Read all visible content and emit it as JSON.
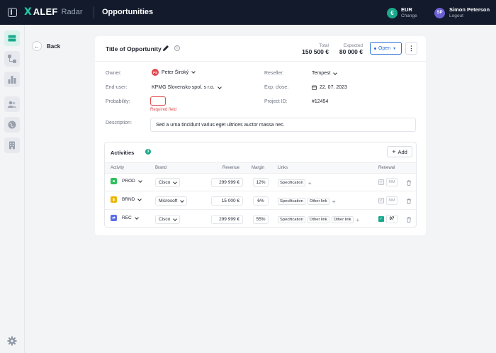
{
  "app": {
    "logo_mark": "X",
    "logo_name": "ALEF",
    "logo_product": "Radar",
    "page_title": "Opportunities"
  },
  "currency": {
    "symbol": "€",
    "code": "EUR",
    "action": "Change"
  },
  "user": {
    "initials": "SP",
    "name": "Simon Peterson",
    "action": "Logout"
  },
  "nav": {
    "back_label": "Back"
  },
  "opportunity": {
    "title": "Title of Opportunity",
    "info_glyph": "i",
    "total_label": "Total",
    "total_value": "150 500 €",
    "expected_label": "Expected",
    "expected_value": "80 000 €",
    "status": "Open",
    "more_glyph": "⋮"
  },
  "form": {
    "owner_label": "Owner:",
    "owner_initials": "PS",
    "owner_value": "Peter Široký",
    "enduser_label": "End-user:",
    "enduser_value": "KPMG Slovensko spol. s r.o.",
    "probability_label": "Probability:",
    "probability_error": "Required field",
    "description_label": "Description:",
    "description_value": "Sed a urna tincidunt varius eget ultrices auctor massa nec.",
    "reseller_label": "Reseller:",
    "reseller_value": "Tempest",
    "expclose_label": "Exp. close:",
    "expclose_value": "22. 07. 2023",
    "projectid_label": "Project ID:",
    "projectid_value": "#12454"
  },
  "activities": {
    "title": "Activities",
    "count": "3",
    "add_label": "Add",
    "columns": {
      "activity": "Activity",
      "brand": "Brand",
      "revenue": "Revenue",
      "margin": "Margin",
      "links": "Links",
      "renewal": "Renewal"
    },
    "rows": [
      {
        "type": "PROD",
        "icon_color": "#2fbf5d",
        "icon_glyph": "■",
        "brand": "Cisco",
        "revenue": "299 999 €",
        "margin": "12%",
        "links": [
          "Specification"
        ],
        "renewal": false,
        "renewal_value": "MM"
      },
      {
        "type": "BRND",
        "icon_color": "#f0b400",
        "icon_glyph": "▮",
        "brand": "Microsoft",
        "revenue": "15 000 €",
        "margin": "6%",
        "links": [
          "Specification",
          "Other link"
        ],
        "renewal": false,
        "renewal_value": "MM"
      },
      {
        "type": "REC",
        "icon_color": "#5b6de6",
        "icon_glyph": "⇄",
        "brand": "Cisco",
        "revenue": "299 999 €",
        "margin": "55%",
        "links": [
          "Specification",
          "Other link",
          "Other link"
        ],
        "renewal": true,
        "renewal_value": "07"
      }
    ]
  }
}
